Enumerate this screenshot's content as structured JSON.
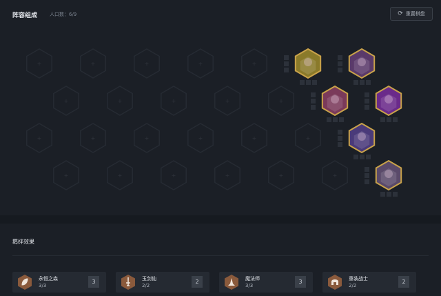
{
  "header": {
    "title": "阵容组成",
    "population": "人口数：6/9",
    "reset_label": "重置棋盘"
  },
  "traits_section": {
    "title": "羁绊效果",
    "traits": [
      {
        "name": "永恒之森",
        "count": "3/3",
        "badge": "3",
        "icon": "leaf-icon"
      },
      {
        "name": "玉剑仙",
        "count": "2/2",
        "badge": "2",
        "icon": "sword-icon"
      },
      {
        "name": "魔法师",
        "count": "3/3",
        "badge": "3",
        "icon": "wizard-hat-icon"
      },
      {
        "name": "重装战士",
        "count": "2/2",
        "badge": "2",
        "icon": "helmet-icon"
      }
    ]
  },
  "board": {
    "champions": [
      {
        "name": "champion-1",
        "row": 0,
        "col": 5,
        "border": "#c9a24a",
        "tone": "#8a7a2a"
      },
      {
        "name": "champion-2",
        "row": 0,
        "col": 6,
        "border": "#c9a24a",
        "tone": "#5a3a6a"
      },
      {
        "name": "champion-3",
        "row": 1,
        "col": 5,
        "border": "#c9a24a",
        "tone": "#7a3a5a"
      },
      {
        "name": "champion-4",
        "row": 1,
        "col": 6,
        "border": "#c9a24a",
        "tone": "#6a2a8a"
      },
      {
        "name": "champion-5",
        "row": 2,
        "col": 6,
        "border": "#c9a24a",
        "tone": "#4a3a7a"
      },
      {
        "name": "champion-6",
        "row": 3,
        "col": 6,
        "border": "#c9a24a",
        "tone": "#5a4a6a"
      }
    ]
  },
  "colors": {
    "background": "#1b1f26",
    "hex_empty": "#262b33",
    "gold_border": "#c9a24a",
    "trait_bronze": "#8a5a3c"
  }
}
